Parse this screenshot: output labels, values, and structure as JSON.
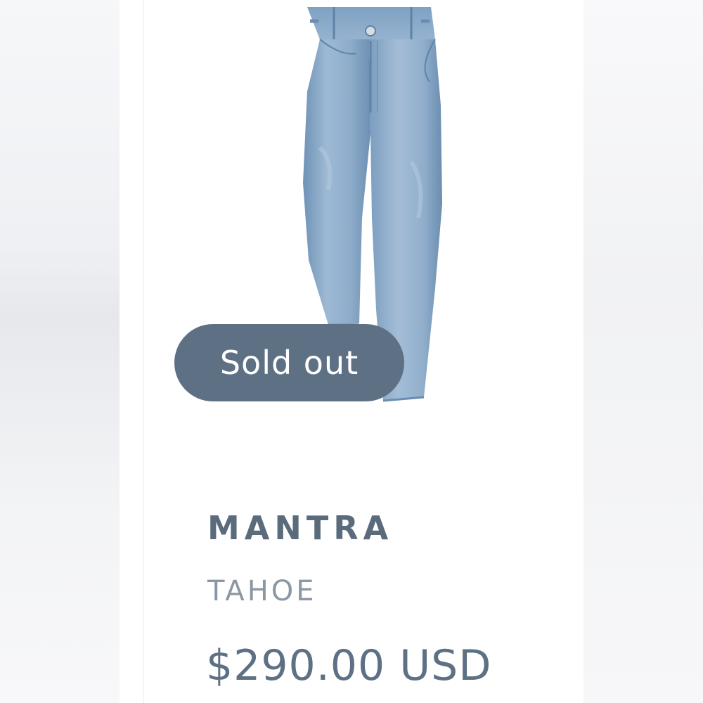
{
  "product": {
    "image_alt": "light wash barrel-leg jeans",
    "badge": "Sold out",
    "brand": "MANTRA",
    "name": "TAHOE",
    "price": "$290.00 USD"
  },
  "colors": {
    "badge_bg": "#5e7184",
    "brand_text": "#5a6b7c",
    "name_text": "#8b97a3",
    "price_text": "#5e7184",
    "denim": "#8fb0cf"
  }
}
